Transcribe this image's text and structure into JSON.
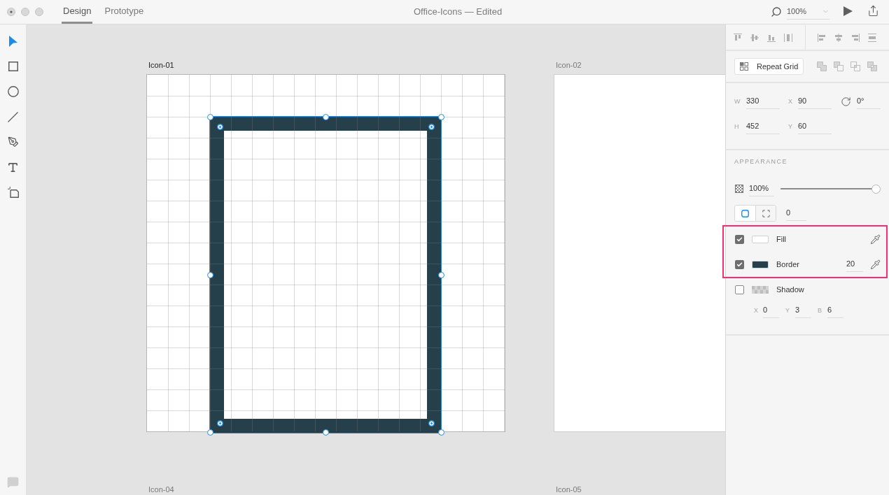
{
  "window": {
    "title": "Office-Icons — Edited"
  },
  "tabs": [
    {
      "label": "Design",
      "selected": true
    },
    {
      "label": "Prototype",
      "selected": false
    }
  ],
  "zoom": {
    "value": "100%"
  },
  "tools": [
    {
      "kind": "select",
      "selected": true
    },
    {
      "kind": "rectangle",
      "selected": false
    },
    {
      "kind": "ellipse",
      "selected": false
    },
    {
      "kind": "line",
      "selected": false
    },
    {
      "kind": "pen",
      "selected": false
    },
    {
      "kind": "text",
      "selected": false
    },
    {
      "kind": "artboard",
      "selected": false
    }
  ],
  "artboards": [
    {
      "label": "Icon-01",
      "selected": true,
      "grid": true,
      "shape": {
        "selected": true
      }
    },
    {
      "label": "Icon-02",
      "selected": false,
      "grid": false
    },
    {
      "label": "Icon-04",
      "selected": false
    },
    {
      "label": "Icon-05",
      "selected": false
    }
  ],
  "properties": {
    "repeat_grid": {
      "label": "Repeat Grid"
    },
    "transform": [
      {
        "label": "W",
        "value": "330"
      },
      {
        "label": "X",
        "value": "90"
      },
      {
        "label": "H",
        "value": "452"
      },
      {
        "label": "Y",
        "value": "60"
      }
    ],
    "rotation": {
      "value": "0°"
    }
  },
  "appearance": {
    "heading": "APPEARANCE",
    "opacity": {
      "value": "100%",
      "level": 1
    },
    "corner_modes": [
      {
        "kind": "all",
        "selected": true
      },
      {
        "kind": "each",
        "selected": false
      }
    ],
    "corner_radius": {
      "value": "0"
    },
    "layers": [
      {
        "kind": "fill",
        "label": "Fill",
        "checked": true,
        "color": "#ffffff",
        "highlighted": true
      },
      {
        "kind": "border",
        "label": "Border",
        "checked": true,
        "color": "#25404a",
        "size": "20",
        "highlighted": true
      },
      {
        "kind": "shadow",
        "label": "Shadow",
        "checked": false,
        "highlighted": false,
        "offsets": [
          {
            "label": "X",
            "value": "0"
          },
          {
            "label": "Y",
            "value": "3"
          },
          {
            "label": "B",
            "value": "6"
          }
        ]
      }
    ]
  }
}
